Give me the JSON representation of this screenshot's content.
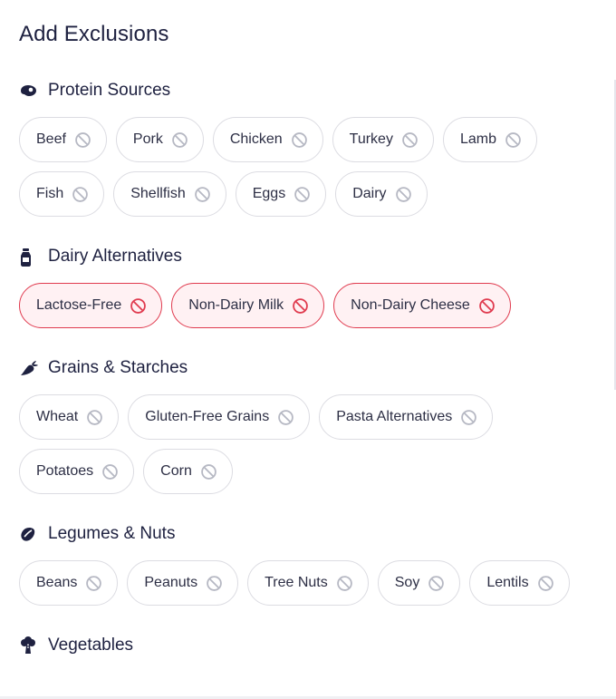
{
  "title": "Add Exclusions",
  "colors": {
    "text": "#1e2140",
    "chip_border": "#dcdce2",
    "active_border": "#e03b4f",
    "active_bg": "#fff1f3",
    "icon_muted": "#b6b8c3",
    "icon_active": "#e03b4f"
  },
  "sections": [
    {
      "title": "Protein Sources",
      "icon": "meat-icon",
      "items": [
        {
          "label": "Beef",
          "active": false
        },
        {
          "label": "Pork",
          "active": false
        },
        {
          "label": "Chicken",
          "active": false
        },
        {
          "label": "Turkey",
          "active": false
        },
        {
          "label": "Lamb",
          "active": false
        },
        {
          "label": "Fish",
          "active": false
        },
        {
          "label": "Shellfish",
          "active": false
        },
        {
          "label": "Eggs",
          "active": false
        },
        {
          "label": "Dairy",
          "active": false
        }
      ]
    },
    {
      "title": "Dairy Alternatives",
      "icon": "milk-bottle-icon",
      "items": [
        {
          "label": "Lactose-Free",
          "active": true
        },
        {
          "label": "Non-Dairy Milk",
          "active": true
        },
        {
          "label": "Non-Dairy Cheese",
          "active": true
        }
      ]
    },
    {
      "title": "Grains & Starches",
      "icon": "carrot-icon",
      "items": [
        {
          "label": "Wheat",
          "active": false
        },
        {
          "label": "Gluten-Free Grains",
          "active": false
        },
        {
          "label": "Pasta Alternatives",
          "active": false
        },
        {
          "label": "Potatoes",
          "active": false
        },
        {
          "label": "Corn",
          "active": false
        }
      ]
    },
    {
      "title": "Legumes & Nuts",
      "icon": "seed-icon",
      "items": [
        {
          "label": "Beans",
          "active": false
        },
        {
          "label": "Peanuts",
          "active": false
        },
        {
          "label": "Tree Nuts",
          "active": false
        },
        {
          "label": "Soy",
          "active": false
        },
        {
          "label": "Lentils",
          "active": false
        }
      ]
    },
    {
      "title": "Vegetables",
      "icon": "broccoli-icon",
      "items": []
    }
  ]
}
